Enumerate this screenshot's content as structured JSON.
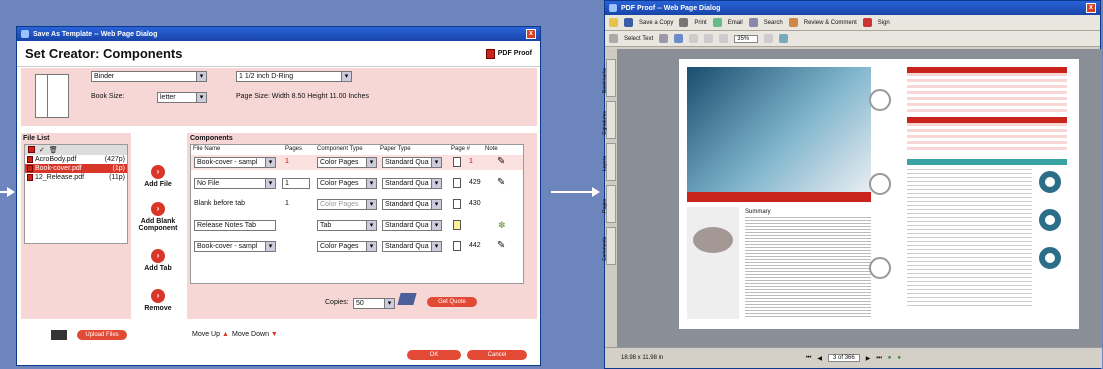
{
  "dialog1": {
    "title": "Save As Template -- Web Page Dialog",
    "heading": "Set Creator: Components",
    "pdf_proof": "PDF Proof",
    "binder": "Binder",
    "ring": "1 1/2 inch D-Ring",
    "book_size_label": "Book Size:",
    "book_size": "letter",
    "page_size": "Page Size: Width 8.50 Height 11.00 Inches",
    "file_list_title": "File List",
    "files": [
      {
        "name": "AcroBody.pdf",
        "pages": "(427p)"
      },
      {
        "name": "Book-cover.pdf",
        "pages": "(1p)"
      },
      {
        "name": "12_Release.pdf",
        "pages": "(11p)"
      }
    ],
    "upload": "Upload Files",
    "actions": {
      "add_file": "Add File",
      "add_blank": "Add Blank Component",
      "add_tab": "Add Tab",
      "remove": "Remove"
    },
    "components_title": "Components",
    "headers": [
      "File Name",
      "Pages",
      "Component Type",
      "Paper Type",
      "Page #",
      "Note"
    ],
    "rows": [
      {
        "file": "Book-cover - sampl",
        "pages": "1",
        "type": "Color Pages",
        "paper": "Standard Qua",
        "pagenum": "1"
      },
      {
        "file": "No File",
        "pages": "1",
        "type": "Color Pages",
        "paper": "Standard Qua",
        "pagenum": "429"
      },
      {
        "file": "Blank before tab",
        "pages": "1",
        "type": "Color Pages",
        "paper": "Standard Qua",
        "pagenum": "430"
      },
      {
        "file": "Release Notes Tab",
        "pages": "",
        "type": "Tab",
        "paper": "Standard Qua",
        "pagenum": ""
      },
      {
        "file": "Book-cover - sampl",
        "pages": "",
        "type": "Color Pages",
        "paper": "Standard Qua",
        "pagenum": "442"
      }
    ],
    "copies_label": "Copies:",
    "copies": "50",
    "get_quote": "Get Quote",
    "move_up": "Move Up",
    "move_down": "Move Down",
    "ok": "OK",
    "cancel": "Cancel"
  },
  "dialog2": {
    "title": "PDF Proof -- Web Page Dialog",
    "toolbar1": [
      "Save a Copy",
      "Print",
      "Email",
      "Search",
      "Review & Comment",
      "Sign"
    ],
    "select_text": "Select Text",
    "zoom": "35%",
    "side_tabs": [
      "Bookmarks",
      "Signatures",
      "Layers",
      "Pages",
      "Comments"
    ],
    "summary_heading": "Summary",
    "page_info": "3 of 366",
    "page_size": "18.98 x 11.98 in"
  },
  "colors": {
    "accent": "#e34a36",
    "pink": "#f6d7d5",
    "titlebar": "#1e4fbf"
  }
}
